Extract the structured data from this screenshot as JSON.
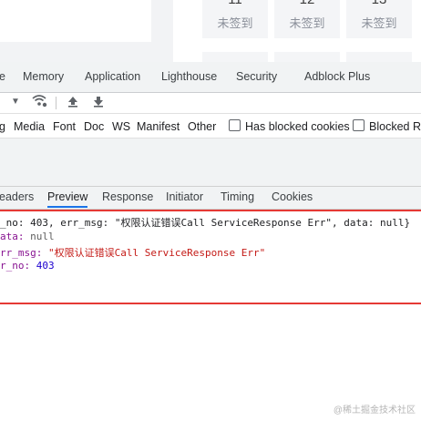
{
  "calendar": [
    {
      "day": "11",
      "status": "未签到"
    },
    {
      "day": "12",
      "status": "未签到"
    },
    {
      "day": "13",
      "status": "未签到"
    }
  ],
  "devtools": {
    "tabs": [
      "e",
      "Memory",
      "Application",
      "Lighthouse",
      "Security",
      "Adblock Plus"
    ],
    "filters": [
      "g",
      "Media",
      "Font",
      "Doc",
      "WS",
      "Manifest",
      "Other"
    ],
    "checkboxes": [
      "Has blocked cookies",
      "Blocked Re"
    ],
    "subtabs": [
      "eaders",
      "Preview",
      "Response",
      "Initiator",
      "Timing",
      "Cookies"
    ],
    "active_subtab": "Preview"
  },
  "preview": {
    "summary_prefix": "_no: 403, err_msg: ",
    "summary_msg": "\"权限认证错误Call ServiceResponse Err\"",
    "summary_suffix": ", data: null}",
    "data_key": "ata",
    "data_value": "null",
    "err_msg_key": "rr_msg",
    "err_msg_value": "\"权限认证错误Call ServiceResponse Err\"",
    "err_no_key": "r_no",
    "err_no_value": "403"
  },
  "watermark": "@稀土掘金技术社区"
}
